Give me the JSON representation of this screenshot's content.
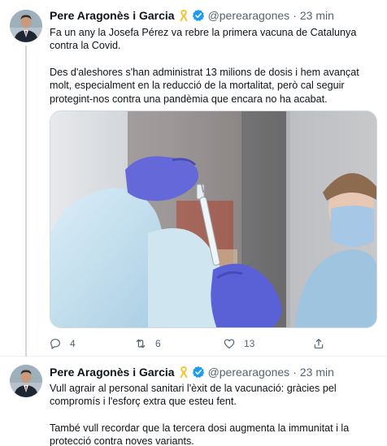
{
  "colors": {
    "verified": "#1d9bf0",
    "ribbon": "#f4c430",
    "meta_text": "#536471",
    "divider": "#eff3f4"
  },
  "icons": {
    "ribbon": "yellow-ribbon-icon",
    "verified": "verified-badge-icon",
    "reply": "reply-icon",
    "retweet": "retweet-icon",
    "like": "heart-icon",
    "share": "share-icon"
  },
  "tweets": [
    {
      "author_name": "Pere Aragonès i Garcia",
      "handle": "@perearagones",
      "separator": "·",
      "time": "23 min",
      "paragraphs": [
        "Fa un any la Josefa Pérez va rebre la primera vacuna de Catalunya contra la Covid.",
        "Des d'aleshores s'han administrat 13 milions de dosis i hem avançat molt, especialment en la reducció de la mortalitat, però cal seguir protegint-nos contra una pandèmia que encara no ha acabat."
      ],
      "replies": "4",
      "retweets": "6",
      "likes": "13"
    },
    {
      "author_name": "Pere Aragonès i Garcia",
      "handle": "@perearagones",
      "separator": "·",
      "time": "23 min",
      "paragraphs": [
        "Vull agrair al personal sanitari l'èxit de la vacunació: gràcies pel compromís i l'esforç extra que esteu fent.",
        "També vull recordar que la tercera dosi augmenta la immunitat i la protecció contra noves variants."
      ]
    }
  ]
}
